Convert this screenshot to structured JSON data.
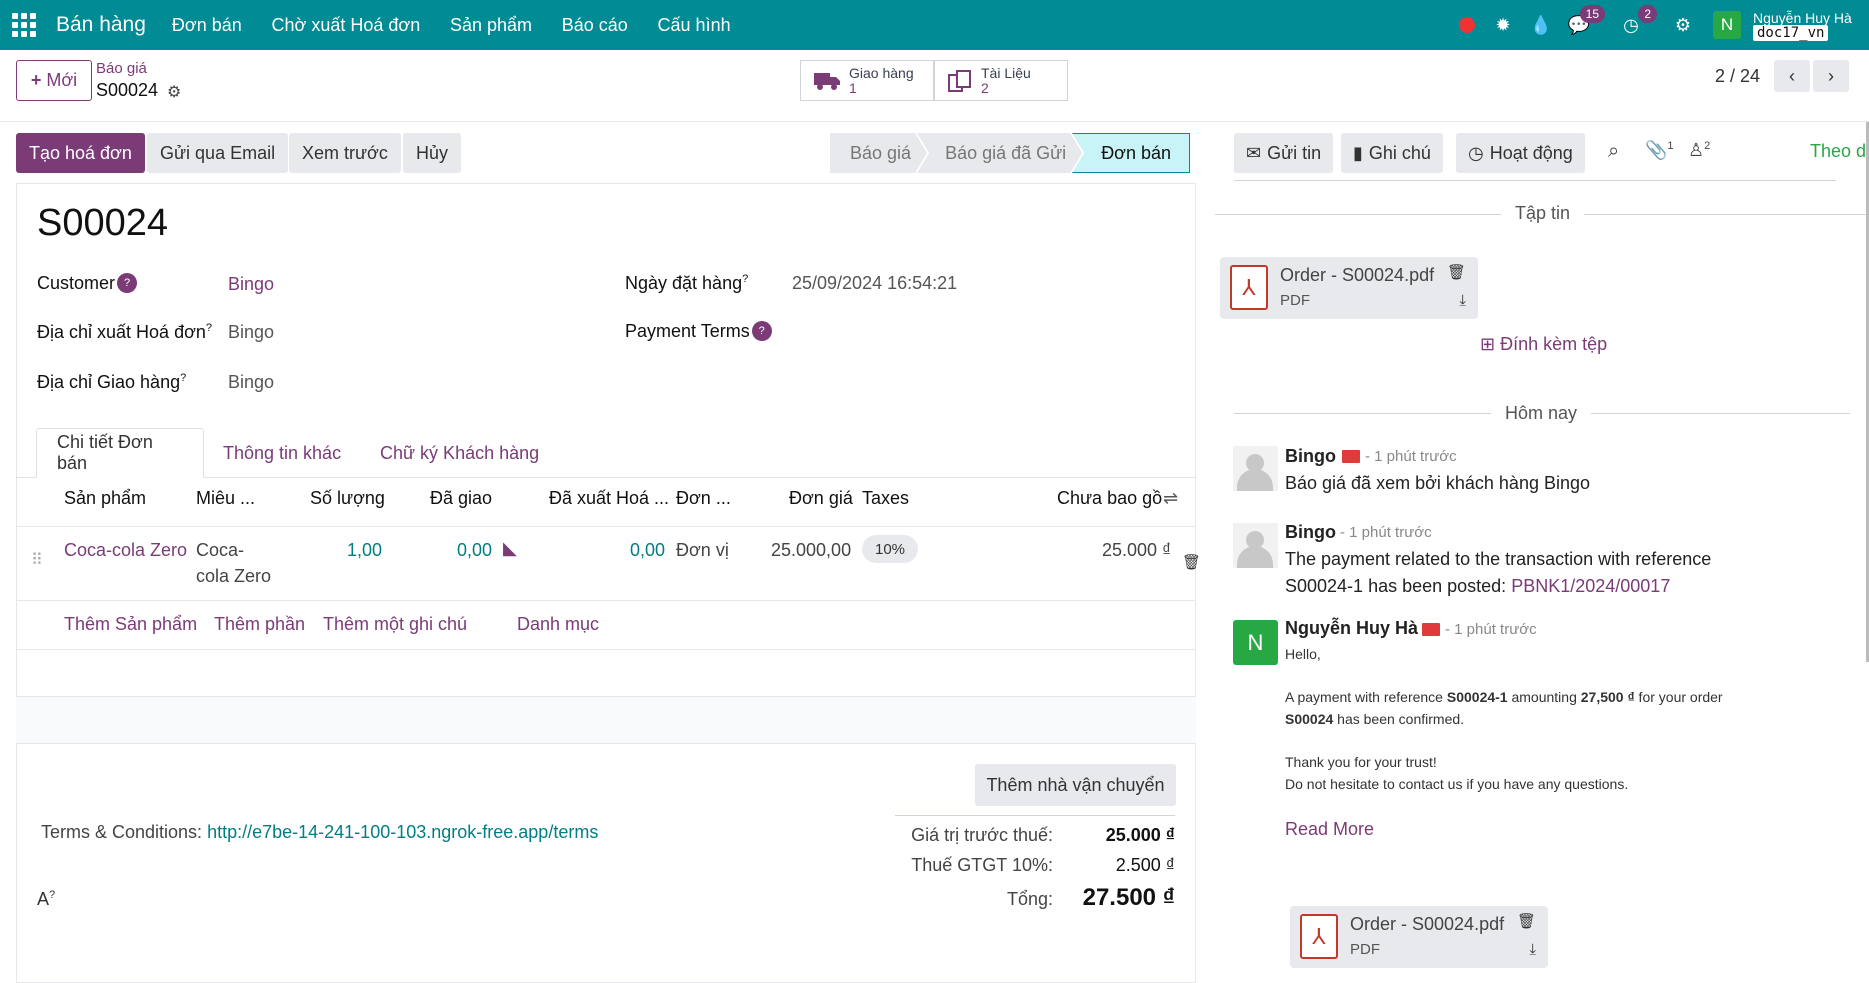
{
  "navbar": {
    "app_name": "Bán hàng",
    "menu": [
      "Đơn bán",
      "Chờ xuất Hoá đơn",
      "Sản phẩm",
      "Báo cáo",
      "Cấu hình"
    ],
    "messages_count": "15",
    "activities_count": "2",
    "avatar_letter": "N",
    "user_name": "Nguyễn Huy Hà",
    "db_name": "doc17_vn"
  },
  "control": {
    "new_label": "Mới",
    "breadcrumb_parent": "Báo giá",
    "breadcrumb_current": "S00024",
    "smart_delivery_label": "Giao hàng",
    "smart_delivery_count": "1",
    "smart_docs_label": "Tài Liệu",
    "smart_docs_count": "2",
    "pager": "2 / 24"
  },
  "statusbar": {
    "buttons": [
      "Tạo hoá đơn",
      "Gửi qua Email",
      "Xem trước",
      "Hủy"
    ],
    "stages": [
      "Báo giá",
      "Báo giá đã Gửi",
      "Đơn bán"
    ],
    "active_stage": "Đơn bán"
  },
  "form": {
    "title": "S00024",
    "customer_label": "Customer",
    "customer_value": "Bingo",
    "invoice_addr_label": "Địa chỉ xuất Hoá đơn",
    "invoice_addr_value": "Bingo",
    "delivery_addr_label": "Địa chỉ Giao hàng",
    "delivery_addr_value": "Bingo",
    "order_date_label": "Ngày đặt hàng",
    "order_date_value": "25/09/2024 16:54:21",
    "payment_terms_label": "Payment Terms",
    "tabs": [
      "Chi tiết Đơn bán",
      "Thông tin khác",
      "Chữ ký Khách hàng"
    ],
    "columns": [
      "Sản phẩm",
      "Miêu ...",
      "Số lượng",
      "Đã giao",
      "Đã xuất Hoá ...",
      "Đơn ...",
      "Đơn giá",
      "Taxes",
      "Chưa bao gồ"
    ],
    "line": {
      "product": "Coca-cola Zero",
      "desc_1": "Coca-",
      "desc_2": "cola Zero",
      "qty": "1,00",
      "delivered": "0,00",
      "invoiced": "0,00",
      "uom": "Đơn vị",
      "price": "25.000,00",
      "tax": "10%",
      "subtotal": "25.000 ₫"
    },
    "add_links": [
      "Thêm Sản phẩm",
      "Thêm phần",
      "Thêm một ghi chú",
      "Danh mục"
    ],
    "carrier_button": "Thêm nhà vận chuyển",
    "terms_label": "Terms & Conditions:",
    "terms_url": "http://e7be-14-241-100-103.ngrok-free.app/terms",
    "note_label": "A",
    "untaxed_label": "Giá trị trước thuế:",
    "untaxed_value": "25.000 ₫",
    "vat_label": "Thuế GTGT 10%:",
    "vat_value": "2.500 ₫",
    "total_label": "Tổng:",
    "total_value": "27.500 ₫"
  },
  "chatter": {
    "send_message": "Gửi tin",
    "log_note": "Ghi chú",
    "activities": "Hoạt động",
    "attachments_count": "1",
    "followers_count": "2",
    "follow_label": "Theo dõ",
    "files_section": "Tập tin",
    "file_name": "Order - S00024.pdf",
    "file_type": "PDF",
    "attach_label": "Đính kèm tệp",
    "today_section": "Hôm nay",
    "messages": [
      {
        "author": "Bingo",
        "time": "- 1 phút trước",
        "body": "Báo giá đã xem bởi khách hàng Bingo"
      },
      {
        "author": "Bingo",
        "time": "- 1 phút trước",
        "body_1": "The payment related to the transaction with reference",
        "body_2": "S00024-1 has been posted:",
        "link": "PBNK1/2024/00017"
      },
      {
        "author": "Nguyễn Huy Hà",
        "time": "- 1 phút trước",
        "greeting": "Hello,",
        "p1_a": "A payment with reference ",
        "p1_ref": "S00024-1",
        "p1_b": " amounting ",
        "p1_amt": "27,500 ₫",
        "p1_c": " for your order",
        "p2_order": "S00024",
        "p2_b": " has been confirmed.",
        "p3": "Thank you for your trust!",
        "p4": "Do not hesitate to contact us if you have any questions.",
        "read_more": "Read More"
      }
    ]
  }
}
